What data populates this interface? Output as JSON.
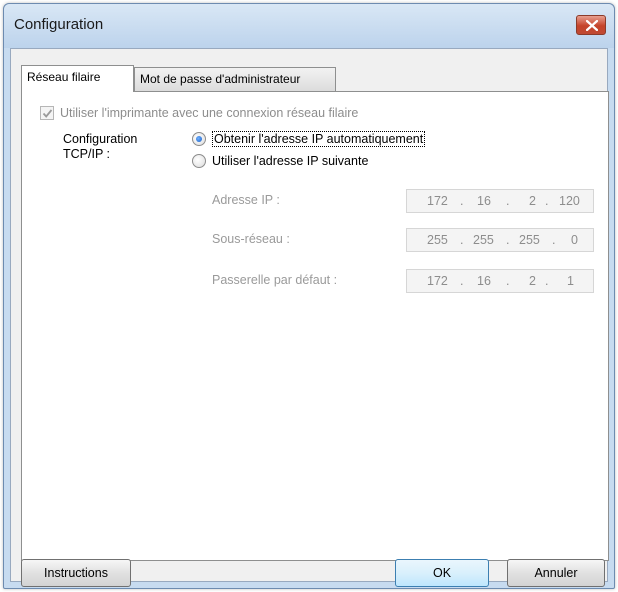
{
  "window": {
    "title": "Configuration"
  },
  "tabs": [
    {
      "label": "Réseau filaire",
      "active": true
    },
    {
      "label": "Mot de passe d'administrateur",
      "active": false
    }
  ],
  "wired": {
    "use_wired_label": "Utiliser l'imprimante avec une connexion réseau filaire",
    "use_wired_checked": true,
    "tcpip_label": "Configuration TCP/IP :",
    "radio_auto": "Obtenir l'adresse IP automatiquement",
    "radio_manual": "Utiliser l'adresse IP suivante",
    "selected": "auto",
    "fields": [
      {
        "label": "Adresse IP :",
        "octets": [
          "172",
          "16",
          "2",
          "120"
        ]
      },
      {
        "label": "Sous-réseau :",
        "octets": [
          "255",
          "255",
          "255",
          "0"
        ]
      },
      {
        "label": "Passerelle par défaut :",
        "octets": [
          "172",
          "16",
          "2",
          "1"
        ]
      }
    ]
  },
  "buttons": {
    "instructions": "Instructions",
    "ok": "OK",
    "cancel": "Annuler"
  },
  "colors": {
    "frame": "#c7dbf0",
    "close": "#c5432a",
    "default_button": "#3c7fb1"
  }
}
